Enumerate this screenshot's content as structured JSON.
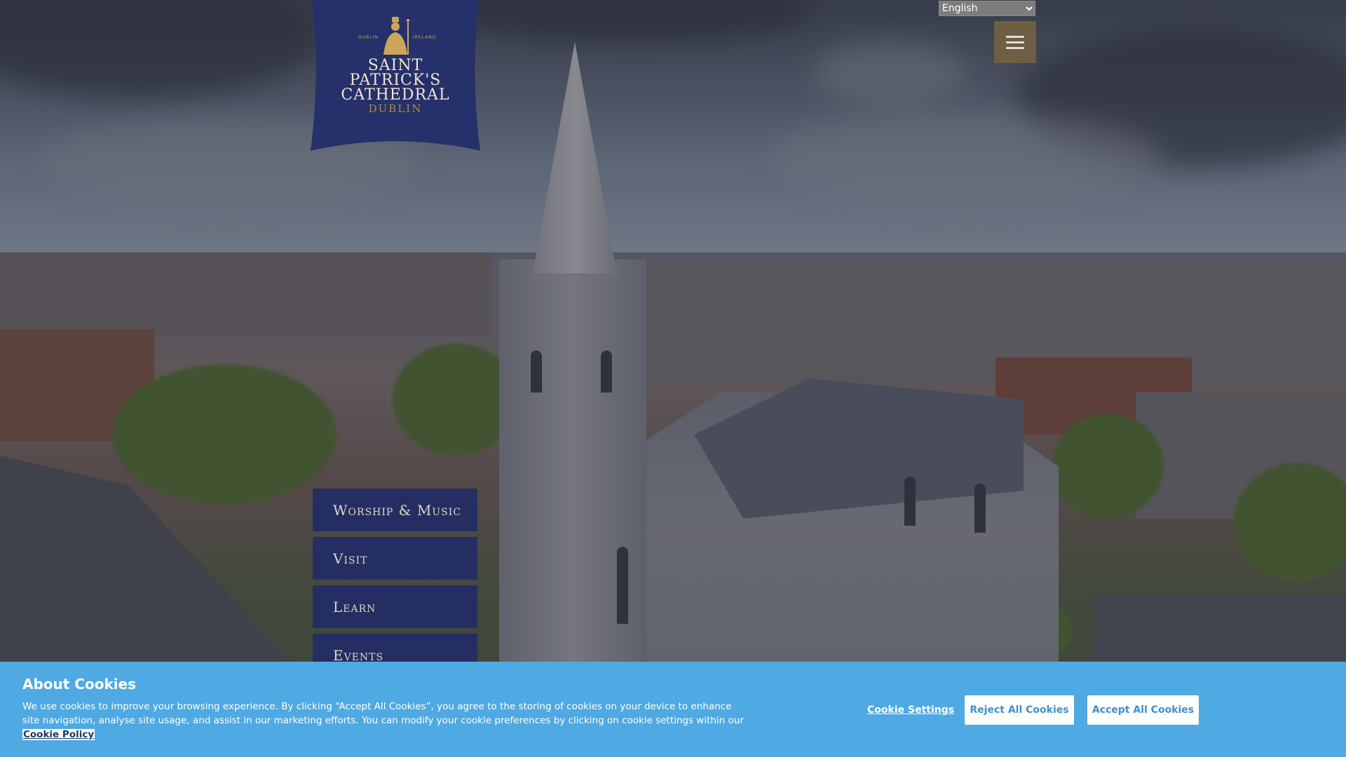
{
  "language": {
    "selected": "English",
    "options": [
      "English"
    ]
  },
  "logo": {
    "line1": "Saint",
    "line2": "Patrick's",
    "line3": "Cathedral",
    "line4": "Dublin",
    "small_left": "DUBLIN",
    "small_right": "IRELAND"
  },
  "nav": {
    "items": [
      {
        "label": "Worship & Music"
      },
      {
        "label": "Visit"
      },
      {
        "label": "Learn"
      },
      {
        "label": "Events"
      }
    ]
  },
  "cookie": {
    "title": "About Cookies",
    "text": "We use cookies to improve your browsing experience. By clicking “Accept All Cookies”, you agree to the storing of cookies on your device to enhance site navigation, analyse site usage, and assist in our marketing efforts. You can modify your cookie preferences by clicking on cookie settings within our",
    "policy_link": "Cookie Policy",
    "settings_label": "Cookie Settings",
    "reject_label": "Reject All Cookies",
    "accept_label": "Accept All Cookies"
  },
  "colors": {
    "logo_bg": "#26306a",
    "nav_bg": "#252e63",
    "menu_btn": "#6e5e43",
    "cookie_bg": "#4fa9e2"
  },
  "icons": {
    "menu": "hamburger-icon",
    "logo_emblem": "saint-figure-emblem"
  }
}
